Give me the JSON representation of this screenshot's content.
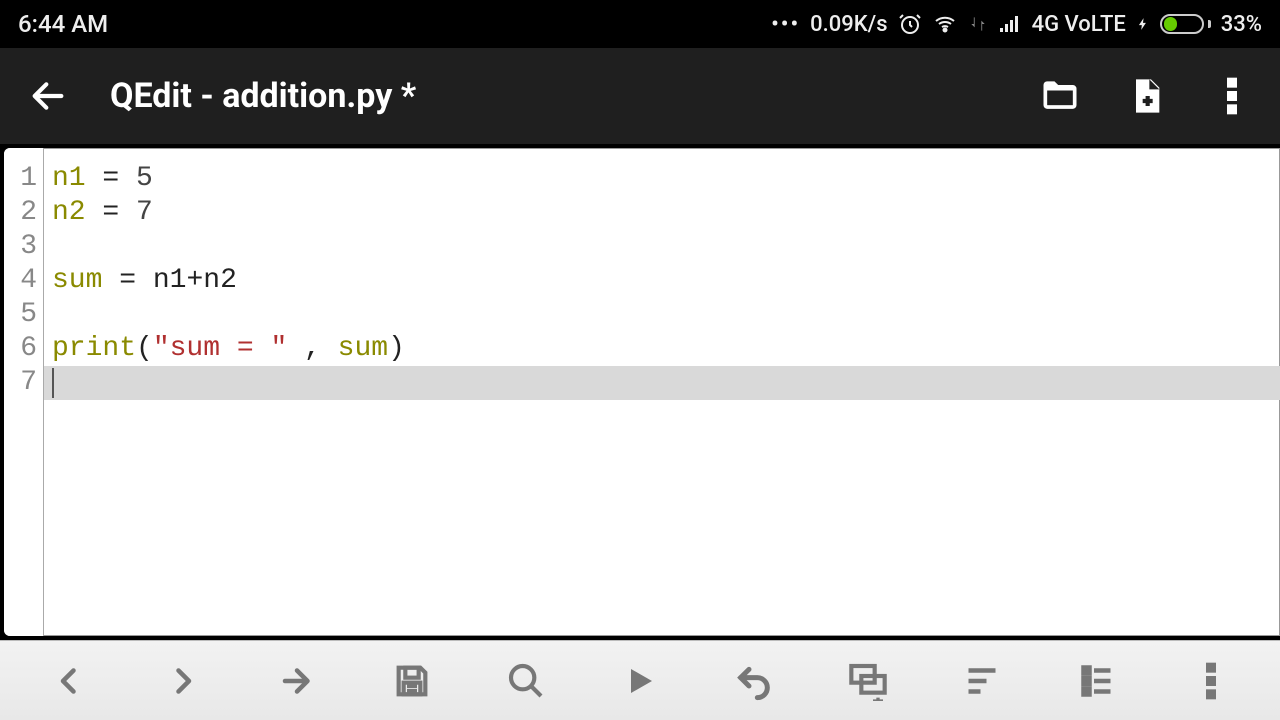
{
  "status": {
    "time": "6:44 AM",
    "speed": "0.09K/s",
    "network_label": "4G VoLTE",
    "battery_pct": "33%"
  },
  "appbar": {
    "title": "QEdit - addition.py *"
  },
  "editor": {
    "line_numbers": [
      "1",
      "2",
      "3",
      "4",
      "5",
      "6",
      "7"
    ],
    "lines": [
      {
        "tokens": [
          {
            "t": "n1",
            "c": "var"
          },
          {
            "t": " = ",
            "c": "op"
          },
          {
            "t": "5",
            "c": "num"
          }
        ]
      },
      {
        "tokens": [
          {
            "t": "n2",
            "c": "var"
          },
          {
            "t": " = ",
            "c": "op"
          },
          {
            "t": "7",
            "c": "num"
          }
        ]
      },
      {
        "tokens": []
      },
      {
        "tokens": [
          {
            "t": "sum",
            "c": "kw"
          },
          {
            "t": " = ",
            "c": "op"
          },
          {
            "t": "n1",
            "c": "op"
          },
          {
            "t": "+",
            "c": "op"
          },
          {
            "t": "n2",
            "c": "op"
          }
        ]
      },
      {
        "tokens": []
      },
      {
        "tokens": [
          {
            "t": "print",
            "c": "kw"
          },
          {
            "t": "(",
            "c": "op"
          },
          {
            "t": "\"sum = \"",
            "c": "str"
          },
          {
            "t": " , ",
            "c": "op"
          },
          {
            "t": "sum",
            "c": "kw"
          },
          {
            "t": ")",
            "c": "op"
          }
        ]
      },
      {
        "tokens": [],
        "current": true
      }
    ]
  }
}
